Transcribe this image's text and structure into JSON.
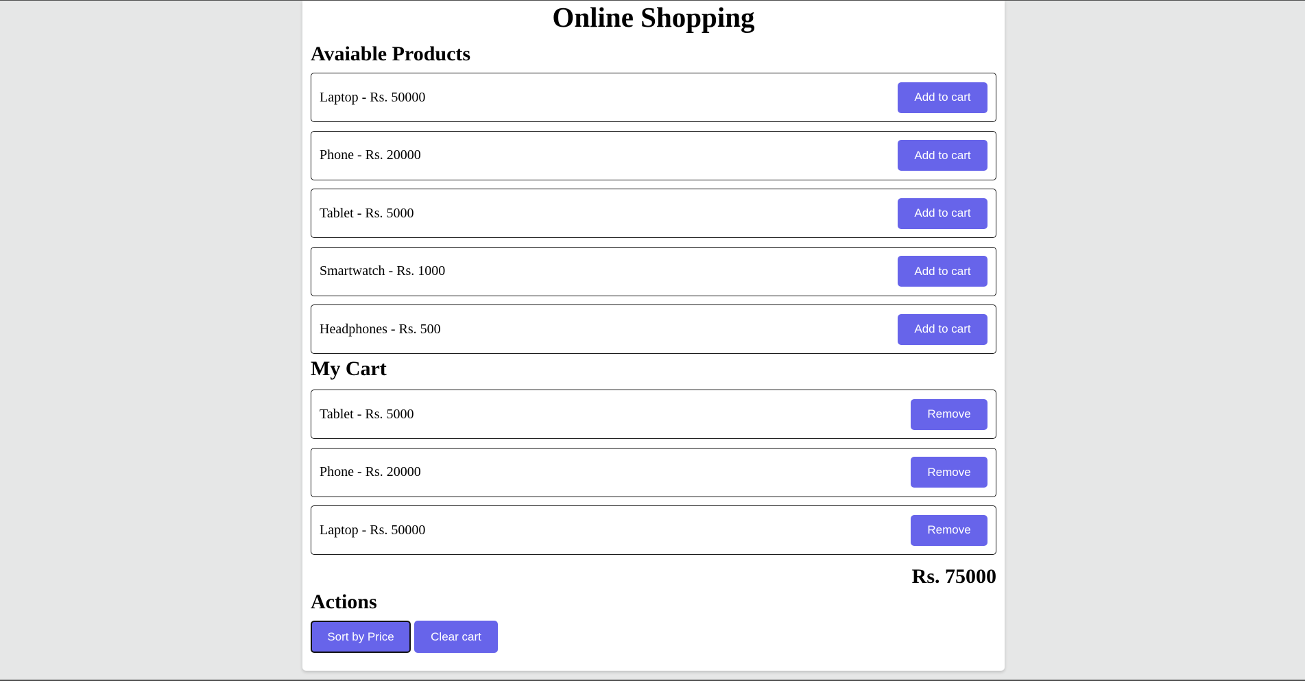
{
  "title": "Online Shopping",
  "products_title": "Avaiable Products",
  "products": [
    {
      "label": "Laptop - Rs. 50000",
      "button": "Add to cart"
    },
    {
      "label": "Phone - Rs. 20000",
      "button": "Add to cart"
    },
    {
      "label": "Tablet - Rs. 5000",
      "button": "Add to cart"
    },
    {
      "label": "Smartwatch - Rs. 1000",
      "button": "Add to cart"
    },
    {
      "label": "Headphones - Rs. 500",
      "button": "Add to cart"
    }
  ],
  "cart_title": "My Cart",
  "cart": [
    {
      "label": "Tablet - Rs. 5000",
      "button": "Remove"
    },
    {
      "label": "Phone - Rs. 20000",
      "button": "Remove"
    },
    {
      "label": "Laptop - Rs. 50000",
      "button": "Remove"
    }
  ],
  "total": "Rs. 75000",
  "actions_title": "Actions",
  "actions": {
    "sort_label": "Sort by Price",
    "clear_label": "Clear cart"
  },
  "colors": {
    "accent": "#6764ea",
    "background": "#e6e7e7",
    "panel": "#ffffff"
  }
}
